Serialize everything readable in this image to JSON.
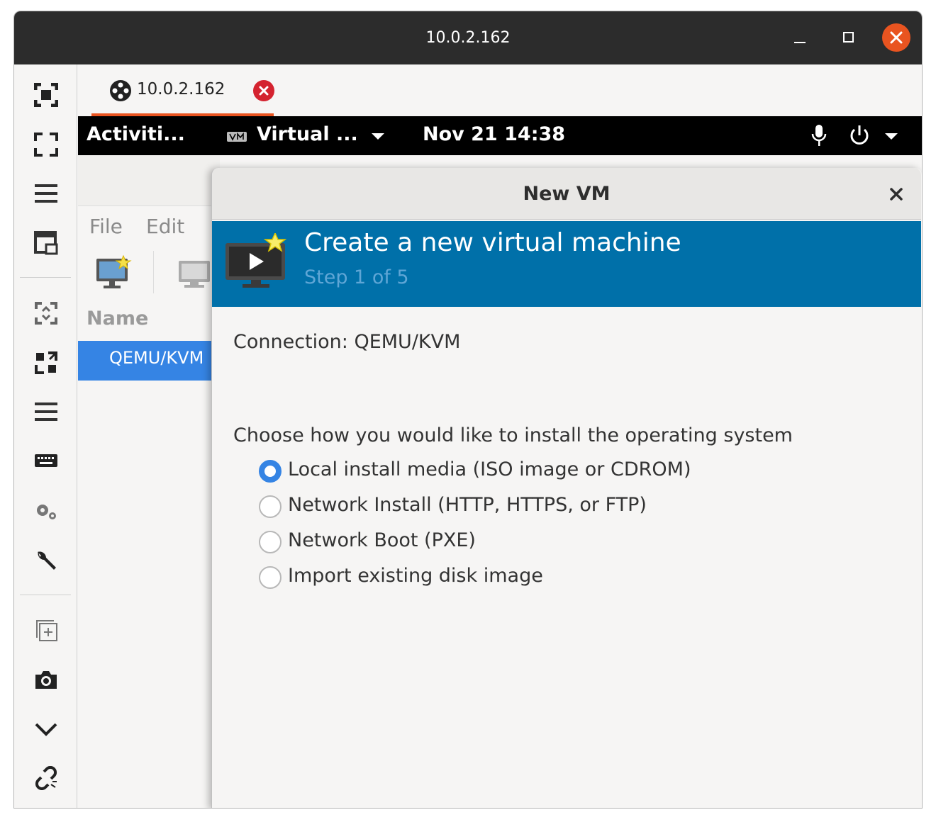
{
  "window": {
    "title": "10.0.2.162"
  },
  "tab": {
    "label": "10.0.2.162"
  },
  "toolbar": {
    "icons": [
      "fit-window-icon",
      "fullscreen-icon",
      "menu-icon",
      "picture-in-picture-icon",
      "scale-icon",
      "resize-icon",
      "menu-icon",
      "keyboard-icon",
      "settings-icon",
      "wrench-icon",
      "new-window-icon",
      "screenshot-icon",
      "chevron-down-icon",
      "disconnect-icon"
    ]
  },
  "gnome_bar": {
    "activities": "Activiti...",
    "app_menu": "Virtual ...",
    "clock": "Nov 21  14:38"
  },
  "virt_manager": {
    "menu": {
      "file": "File",
      "edit": "Edit"
    },
    "column_name": "Name",
    "connection": "QEMU/KVM"
  },
  "dialog": {
    "title": "New VM",
    "banner_title": "Create a new virtual machine",
    "banner_step": "Step 1 of 5",
    "connection_label": "Connection: QEMU/KVM",
    "choose_label": "Choose how you would like to install the operating system",
    "options": [
      {
        "label": "Local install media (ISO image or CDROM)",
        "checked": true
      },
      {
        "label": "Network Install (HTTP, HTTPS, or FTP)",
        "checked": false
      },
      {
        "label": "Network Boot (PXE)",
        "checked": false
      },
      {
        "label": "Import existing disk image",
        "checked": false
      }
    ]
  },
  "colors": {
    "accent": "#e95420",
    "selection": "#3584e4",
    "banner": "#0070a9",
    "tab_close": "#d4232f"
  }
}
